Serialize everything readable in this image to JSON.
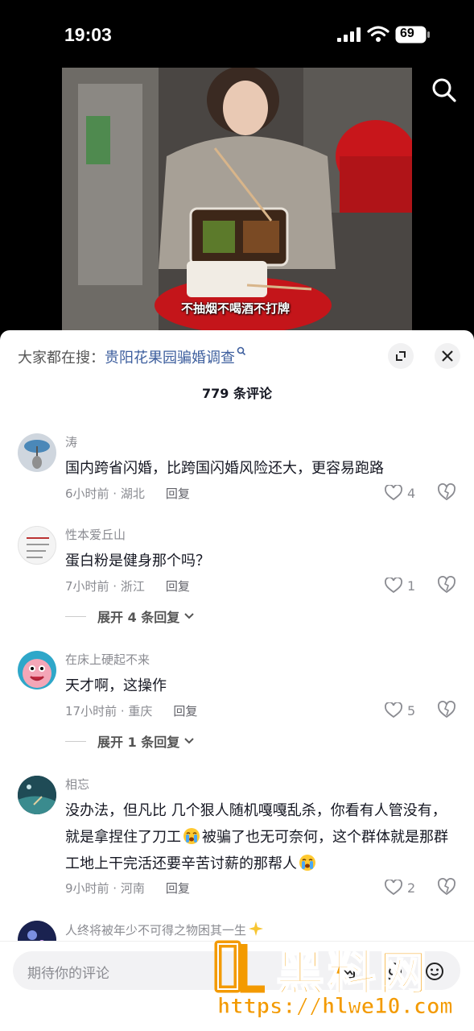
{
  "status": {
    "time": "19:03",
    "battery": "69"
  },
  "video": {
    "subtitle": "不抽烟不喝酒不打牌"
  },
  "sheet": {
    "suggest_prefix": "大家都在搜：",
    "suggest_query": "贵阳花果园骗婚调查",
    "comment_count": "779 条评论"
  },
  "comments": [
    {
      "name": "涛",
      "text": "国内跨省闪婚，比跨国闪婚风险还大，更容易跑路",
      "time": "6小时前 · 湖北",
      "reply": "回复",
      "likes": "4"
    },
    {
      "name": "性本爱丘山",
      "text": "蛋白粉是健身那个吗？",
      "time": "7小时前 · 浙江",
      "reply": "回复",
      "likes": "1",
      "more": "展开 4 条回复"
    },
    {
      "name": "在床上硬起不来",
      "text": "天才啊，这操作",
      "time": "17小时前 · 重庆",
      "reply": "回复",
      "likes": "5",
      "more": "展开 1 条回复"
    },
    {
      "name": "相忘",
      "text_1": "没办法，但凡比 几个狠人随机嘎嘎乱杀，你看有人管没有，就是拿捏住了刀工",
      "text_2": "被骗了也无可奈何，这个群体就是那群工地上干完活还要辛苦讨薪的那帮人",
      "time": "9小时前 · 河南",
      "reply": "回复",
      "likes": "2"
    },
    {
      "name": "人终将被年少不可得之物困其一生"
    }
  ],
  "input": {
    "placeholder": "期待你的评论"
  },
  "watermark": {
    "brand": "黑料网",
    "url": "https://hlwe10.com"
  },
  "colors": {
    "accent_link": "#3e5f9e",
    "watermark": "#f39a00"
  },
  "icons": [
    "signal-icon",
    "wifi-icon",
    "battery-icon",
    "search-icon",
    "expand-icon",
    "close-icon",
    "heart-icon",
    "dislike-icon",
    "crying-emoji-icon",
    "sparkle-emoji-icon",
    "at-icon",
    "emoji-icon",
    "image-icon"
  ]
}
